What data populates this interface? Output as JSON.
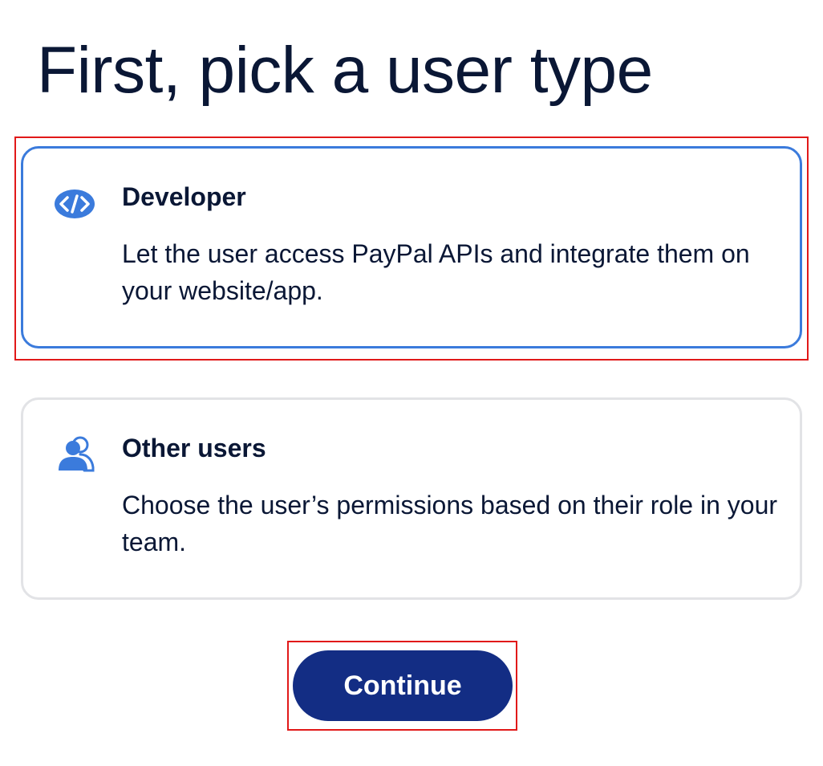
{
  "page": {
    "title": "First, pick a user type"
  },
  "options": [
    {
      "title": "Developer",
      "description": "Let the user access PayPal APIs and integrate them on your website/app.",
      "icon": "code-icon",
      "selected": true
    },
    {
      "title": "Other users",
      "description": "Choose the user’s permissions based on their role in your team.",
      "icon": "users-icon",
      "selected": false
    }
  ],
  "actions": {
    "continue_label": "Continue"
  },
  "colors": {
    "title_text": "#0a1735",
    "selected_border": "#3b7bdc",
    "unselected_border": "#e2e3e6",
    "icon_blue": "#3b7bdc",
    "button_bg": "#132d84",
    "button_text": "#ffffff",
    "highlight": "#e11919"
  }
}
